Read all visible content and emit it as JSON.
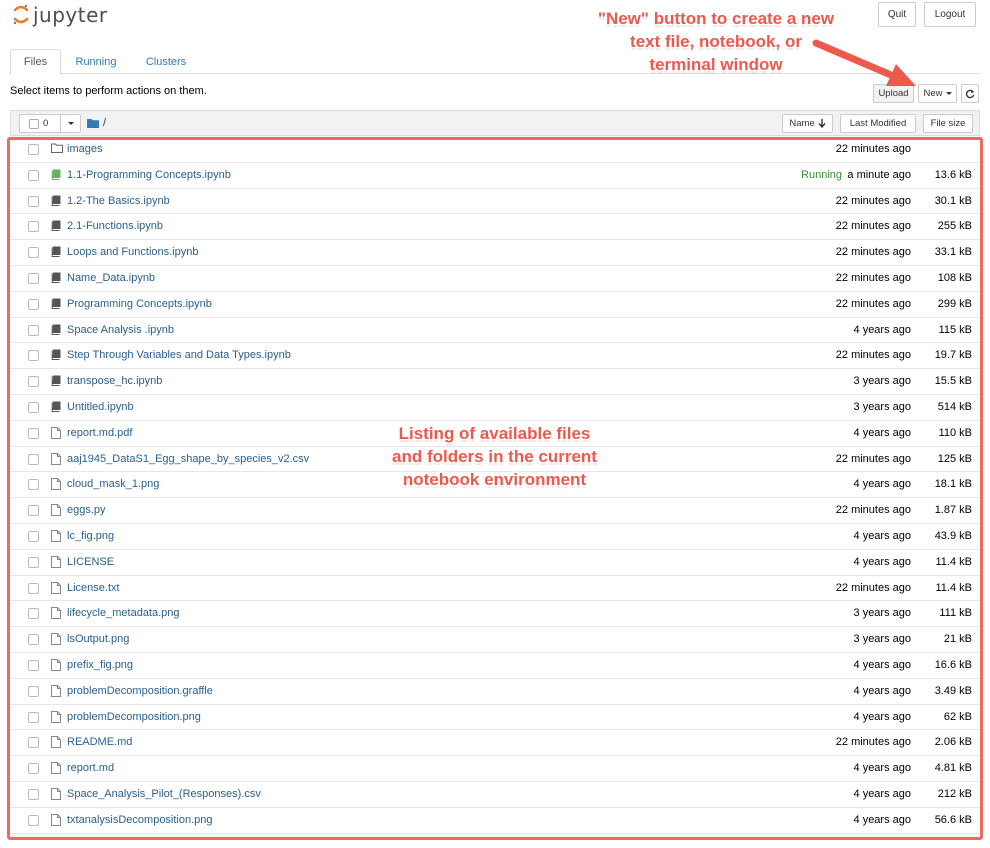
{
  "header": {
    "logo_text": "jupyter",
    "quit_label": "Quit",
    "logout_label": "Logout"
  },
  "tabs": [
    {
      "label": "Files",
      "active": true
    },
    {
      "label": "Running",
      "active": false
    },
    {
      "label": "Clusters",
      "active": false
    }
  ],
  "toolbar": {
    "select_hint": "Select items to perform actions on them.",
    "upload_label": "Upload",
    "new_label": "New"
  },
  "list_header": {
    "selected_count": "0",
    "breadcrumb_path": "/",
    "name_sort_label": "Name",
    "last_modified_label": "Last Modified",
    "file_size_label": "File size"
  },
  "files": [
    {
      "name": "images",
      "type": "folder",
      "status": "",
      "modified": "22 minutes ago",
      "size": ""
    },
    {
      "name": "1.1-Programming Concepts.ipynb",
      "type": "notebook-running",
      "status": "Running",
      "modified": "a minute ago",
      "size": "13.6 kB"
    },
    {
      "name": "1.2-The Basics.ipynb",
      "type": "notebook",
      "status": "",
      "modified": "22 minutes ago",
      "size": "30.1 kB"
    },
    {
      "name": "2.1-Functions.ipynb",
      "type": "notebook",
      "status": "",
      "modified": "22 minutes ago",
      "size": "255 kB"
    },
    {
      "name": "Loops and Functions.ipynb",
      "type": "notebook",
      "status": "",
      "modified": "22 minutes ago",
      "size": "33.1 kB"
    },
    {
      "name": "Name_Data.ipynb",
      "type": "notebook",
      "status": "",
      "modified": "22 minutes ago",
      "size": "108 kB"
    },
    {
      "name": "Programming Concepts.ipynb",
      "type": "notebook",
      "status": "",
      "modified": "22 minutes ago",
      "size": "299 kB"
    },
    {
      "name": "Space Analysis .ipynb",
      "type": "notebook",
      "status": "",
      "modified": "4 years ago",
      "size": "115 kB"
    },
    {
      "name": "Step Through Variables and Data Types.ipynb",
      "type": "notebook",
      "status": "",
      "modified": "22 minutes ago",
      "size": "19.7 kB"
    },
    {
      "name": "transpose_hc.ipynb",
      "type": "notebook",
      "status": "",
      "modified": "3 years ago",
      "size": "15.5 kB"
    },
    {
      "name": "Untitled.ipynb",
      "type": "notebook",
      "status": "",
      "modified": "3 years ago",
      "size": "514 kB"
    },
    {
      "name": " report.md.pdf",
      "type": "file",
      "status": "",
      "modified": "4 years ago",
      "size": "110 kB"
    },
    {
      "name": "aaj1945_DataS1_Egg_shape_by_species_v2.csv",
      "type": "file",
      "status": "",
      "modified": "22 minutes ago",
      "size": "125 kB"
    },
    {
      "name": "cloud_mask_1.png",
      "type": "file",
      "status": "",
      "modified": "4 years ago",
      "size": "18.1 kB"
    },
    {
      "name": "eggs.py",
      "type": "file",
      "status": "",
      "modified": "22 minutes ago",
      "size": "1.87 kB"
    },
    {
      "name": "lc_fig.png",
      "type": "file",
      "status": "",
      "modified": "4 years ago",
      "size": "43.9 kB"
    },
    {
      "name": "LICENSE",
      "type": "file",
      "status": "",
      "modified": "4 years ago",
      "size": "11.4 kB"
    },
    {
      "name": "License.txt",
      "type": "file",
      "status": "",
      "modified": "22 minutes ago",
      "size": "11.4 kB"
    },
    {
      "name": "lifecycle_metadata.png",
      "type": "file",
      "status": "",
      "modified": "3 years ago",
      "size": "111 kB"
    },
    {
      "name": "lsOutput.png",
      "type": "file",
      "status": "",
      "modified": "3 years ago",
      "size": "21 kB"
    },
    {
      "name": "prefix_fig.png",
      "type": "file",
      "status": "",
      "modified": "4 years ago",
      "size": "16.6 kB"
    },
    {
      "name": "problemDecomposition.graffle",
      "type": "file",
      "status": "",
      "modified": "4 years ago",
      "size": "3.49 kB"
    },
    {
      "name": "problemDecomposition.png",
      "type": "file",
      "status": "",
      "modified": "4 years ago",
      "size": "62 kB"
    },
    {
      "name": "README.md",
      "type": "file",
      "status": "",
      "modified": "22 minutes ago",
      "size": "2.06 kB"
    },
    {
      "name": "report.md",
      "type": "file",
      "status": "",
      "modified": "4 years ago",
      "size": "4.81 kB"
    },
    {
      "name": "Space_Analysis_Pilot_(Responses).csv",
      "type": "file",
      "status": "",
      "modified": "4 years ago",
      "size": "212 kB"
    },
    {
      "name": "txtanalysisDecomposition.png",
      "type": "file",
      "status": "",
      "modified": "4 years ago",
      "size": "56.6 kB"
    }
  ],
  "annotations": {
    "new_button_callout": "\"New\" button to create a new text file, notebook, or terminal window",
    "listing_callout": "Listing of available files and folders in the current notebook environment"
  },
  "colors": {
    "link": "#295f8f",
    "running": "#3c8d36",
    "annotation": "#ec5a4e",
    "jupyter_orange": "#f37726"
  }
}
